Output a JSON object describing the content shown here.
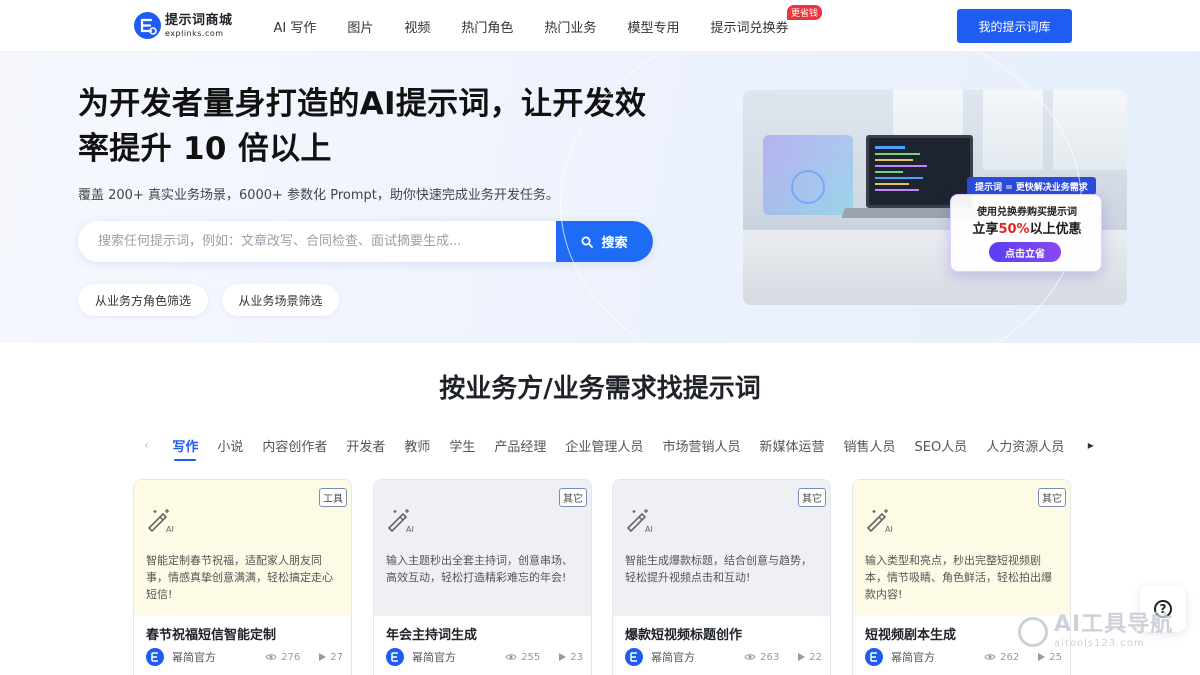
{
  "header": {
    "logo_title": "提示词商城",
    "logo_sub": "explinks.com",
    "nav": [
      {
        "label": "AI 写作"
      },
      {
        "label": "图片"
      },
      {
        "label": "视频"
      },
      {
        "label": "热门角色"
      },
      {
        "label": "热门业务"
      },
      {
        "label": "模型专用"
      },
      {
        "label": "提示词兑换券",
        "badge": "更省钱"
      }
    ],
    "library_button": "我的提示词库"
  },
  "hero": {
    "title": "为开发者量身打造的AI提示词，让开发效率提升 10 倍以上",
    "subtitle": "覆盖 200+ 真实业务场景，6000+ 参数化 Prompt，助你快速完成业务开发任务。",
    "search_placeholder": "搜索任何提示词，例如：文章改写、合同检查、面试摘要生成...",
    "search_button": "搜索",
    "filters": [
      "从业务方角色筛选",
      "从业务场景筛选"
    ],
    "banner": {
      "tag": "提示词 = 更快解决业务需求",
      "line1": "使用兑换券购买提示词",
      "line2_prefix": "立享",
      "line2_highlight": "50%",
      "line2_suffix": "以上优惠",
      "cta": "点击立省"
    }
  },
  "section": {
    "title": "按业务方/业务需求找提示词",
    "tabs": [
      "写作",
      "小说",
      "内容创作者",
      "开发者",
      "教师",
      "学生",
      "产品经理",
      "企业管理人员",
      "市场营销人员",
      "新媒体运营",
      "销售人员",
      "SEO人员",
      "人力资源人员"
    ],
    "active_tab": 0
  },
  "cards": [
    {
      "tag": "工具",
      "desc": "智能定制春节祝福，适配家人朋友同事，情感真挚创意满满，轻松搞定走心短信!",
      "title": "春节祝福短信智能定制",
      "author": "幂简官方",
      "views": "276",
      "plays": "27",
      "theme": "yellow"
    },
    {
      "tag": "其它",
      "desc": "输入主题秒出全套主持词，创意串场、高效互动，轻松打造精彩难忘的年会!",
      "title": "年会主持词生成",
      "author": "幂简官方",
      "views": "255",
      "plays": "23",
      "theme": "gray"
    },
    {
      "tag": "其它",
      "desc": "智能生成爆款标题，结合创意与趋势，轻松提升视频点击和互动!",
      "title": "爆款短视频标题创作",
      "author": "幂简官方",
      "views": "263",
      "plays": "22",
      "theme": "gray"
    },
    {
      "tag": "其它",
      "desc": "输入类型和亮点，秒出完整短视频剧本，情节吸睛、角色鲜活，轻松拍出爆款内容!",
      "title": "短视频剧本生成",
      "author": "幂简官方",
      "views": "262",
      "plays": "25",
      "theme": "yellow"
    }
  ],
  "watermark": {
    "title": "AI工具导航",
    "url": "aitools123.com"
  },
  "colors": {
    "brand": "#1e5cf2",
    "badge": "#e8383d",
    "highlight": "#e52525"
  }
}
